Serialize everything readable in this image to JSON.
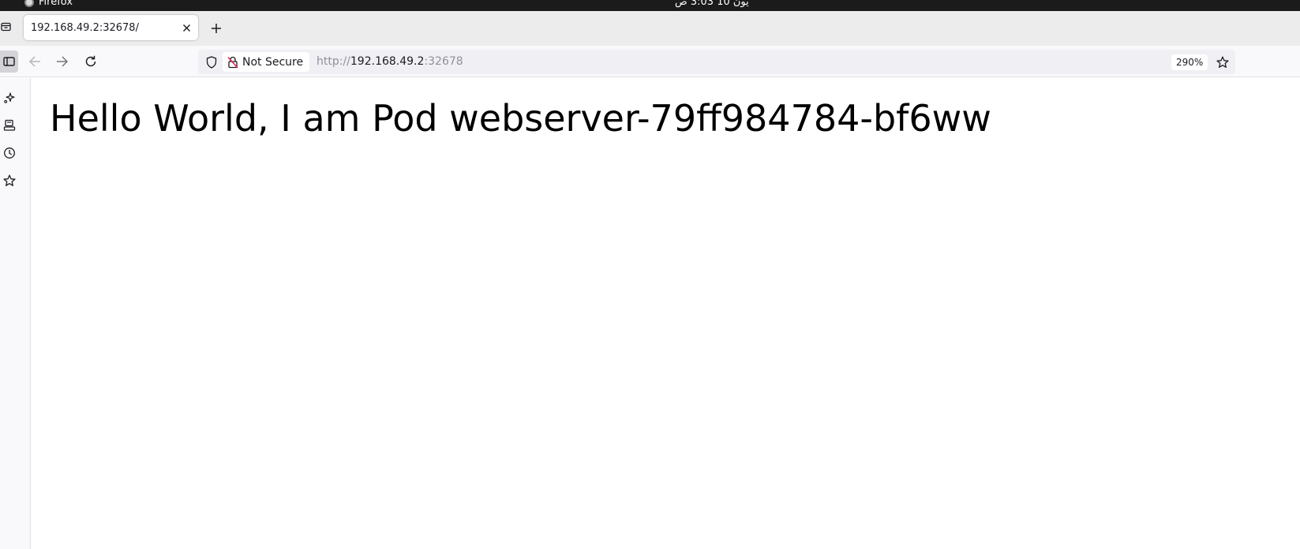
{
  "os": {
    "app_name": "Firefox",
    "clock": "يون 10  3:03 ص"
  },
  "tabs": [
    {
      "title": "192.168.49.2:32678/",
      "active": true
    }
  ],
  "toolbar": {
    "security_label": "Not Secure",
    "url": {
      "scheme": "http://",
      "host": "192.168.49.2",
      "port": ":32678"
    },
    "zoom": "290%"
  },
  "icons": {
    "tab_overview": "tab-overview-icon",
    "close_tab": "close-icon",
    "new_tab": "plus-icon",
    "sidebar_toggle": "sidebar-icon",
    "back": "arrow-left-icon",
    "forward": "arrow-right-icon",
    "reload": "reload-icon",
    "shield": "shield-icon",
    "insecure_lock": "lock-slash-icon",
    "bookmark": "star-icon",
    "ai_chat": "sparkle-icon",
    "synced_tabs": "devices-icon",
    "history": "clock-icon",
    "bookmarks_sidebar": "star-icon"
  },
  "colors": {
    "os_bar": "#1b1b1b",
    "tab_strip": "#ececec",
    "toolbar": "#f9f9fb",
    "urlbar": "#f0f0f4",
    "insecure_icon": "#e22850"
  },
  "page": {
    "heading": "Hello World, I am Pod webserver-79ff984784-bf6ww"
  }
}
